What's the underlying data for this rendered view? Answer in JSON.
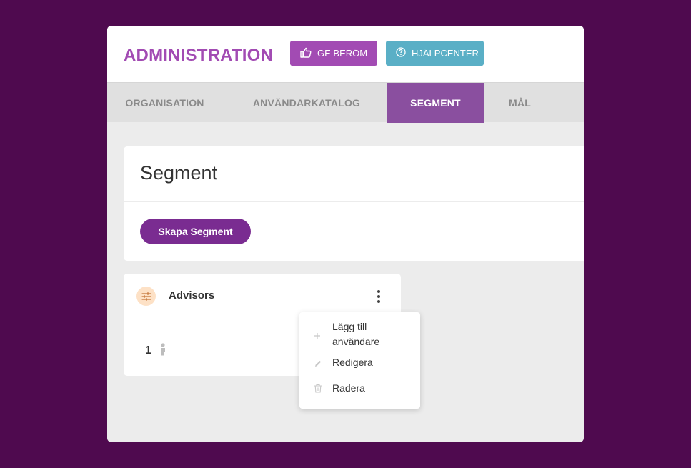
{
  "header": {
    "title": "ADMINISTRATION",
    "praise_label": "GE BERÖM",
    "help_label": "HJÄLPCENTER"
  },
  "tabs": [
    {
      "label": "ORGANISATION",
      "active": false
    },
    {
      "label": "ANVÄNDARKATALOG",
      "active": false
    },
    {
      "label": "SEGMENT",
      "active": true
    },
    {
      "label": "MÅL",
      "active": false
    }
  ],
  "segment_section": {
    "heading": "Segment",
    "create_label": "Skapa Segment"
  },
  "segments": [
    {
      "name": "Advisors",
      "member_count": "1",
      "icon": "sliders-icon"
    }
  ],
  "context_menu": {
    "items": [
      {
        "label": "Lägg till användare",
        "icon": "plus-icon"
      },
      {
        "label": "Redigera",
        "icon": "pencil-icon"
      },
      {
        "label": "Radera",
        "icon": "trash-icon"
      }
    ]
  },
  "colors": {
    "background": "#4f0a4f",
    "title": "#a24bb3",
    "praise_button": "#a24bb3",
    "help_button": "#5aafc6",
    "active_tab": "#8a4f9f",
    "create_button": "#7a2c91",
    "segment_icon_bg": "#fde1c6"
  }
}
